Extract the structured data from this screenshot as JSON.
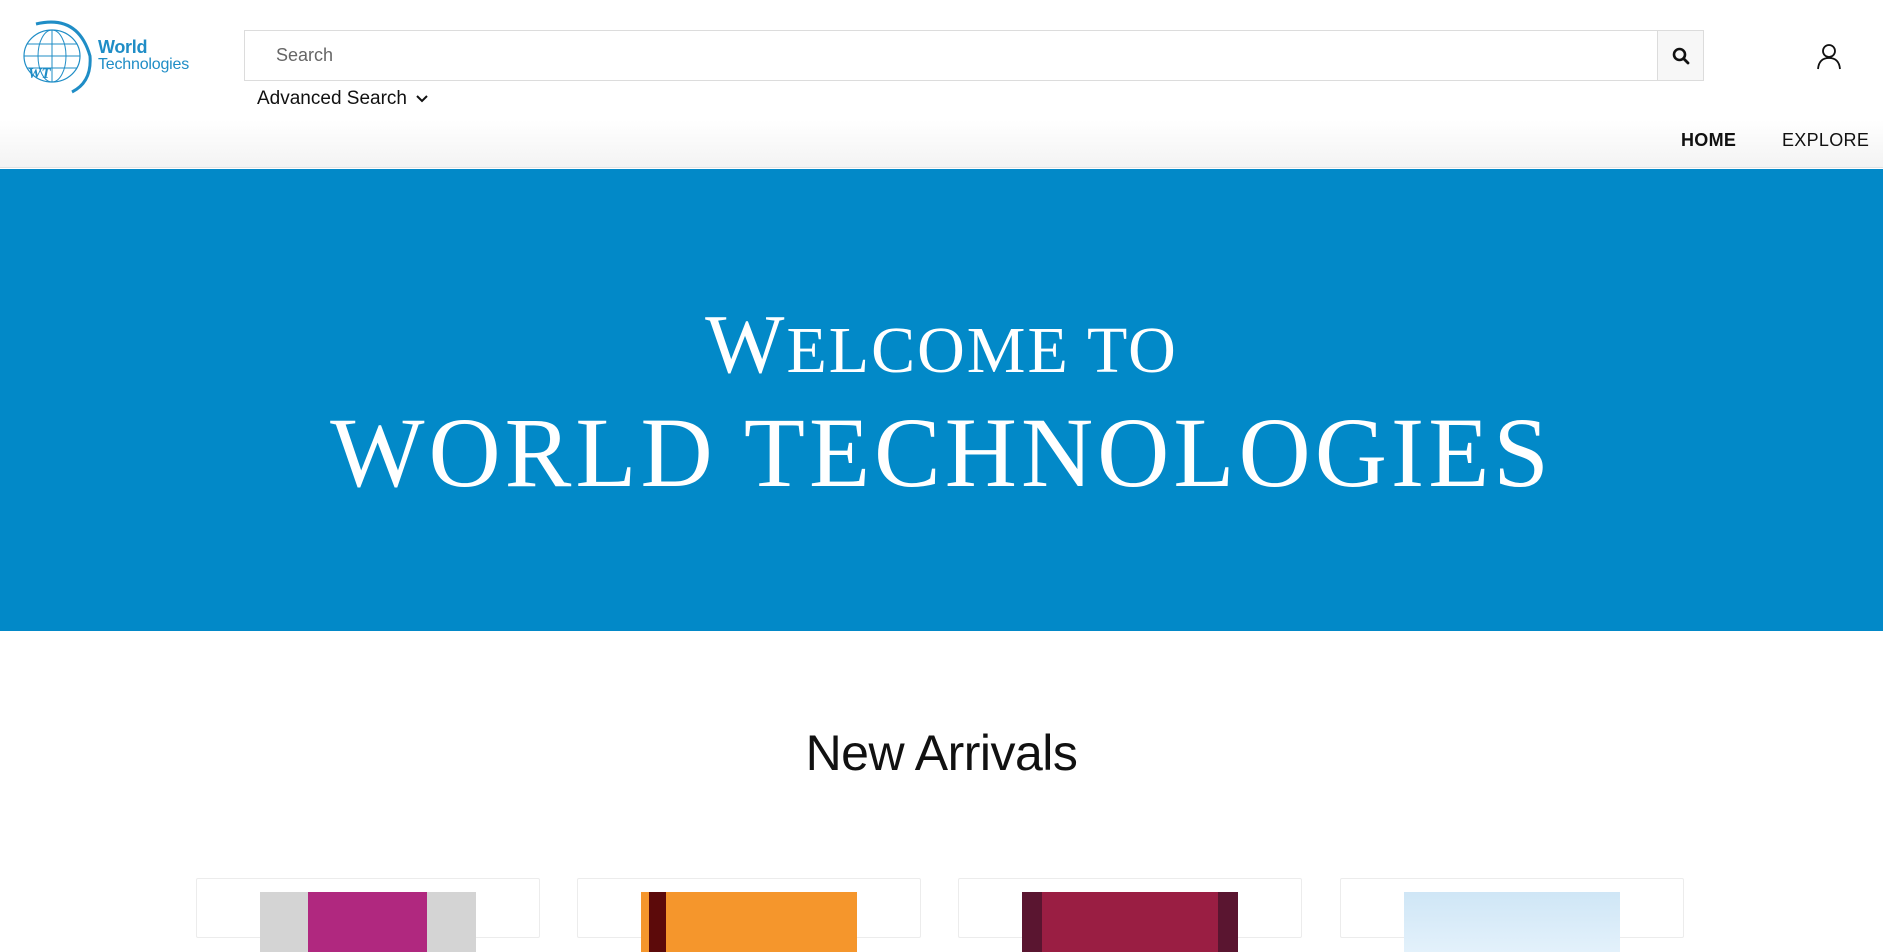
{
  "brand": {
    "name_line1": "World",
    "name_line2": "Technologies",
    "monogram": "WT",
    "color": "#1f8dc6"
  },
  "search": {
    "placeholder": "Search",
    "value": "",
    "button_icon": "search-icon"
  },
  "advanced_search": {
    "label": "Advanced Search",
    "icon": "chevron-down-icon"
  },
  "user": {
    "icon": "user-icon"
  },
  "nav": {
    "items": [
      {
        "label": "HOME",
        "active": true
      },
      {
        "label": "EXPLORE",
        "active": false
      }
    ]
  },
  "hero": {
    "line1_first": "W",
    "line1_rest": "ELCOME TO",
    "line2": "WORLD TECHNOLOGIES",
    "background": "#0289c8"
  },
  "new_arrivals": {
    "title": "New Arrivals",
    "books": [
      {
        "cover_color": "#b0287f"
      },
      {
        "cover_color": "#f5962c"
      },
      {
        "cover_color": "#9a1e43"
      },
      {
        "cover_color": "#cfe6f6"
      }
    ]
  }
}
